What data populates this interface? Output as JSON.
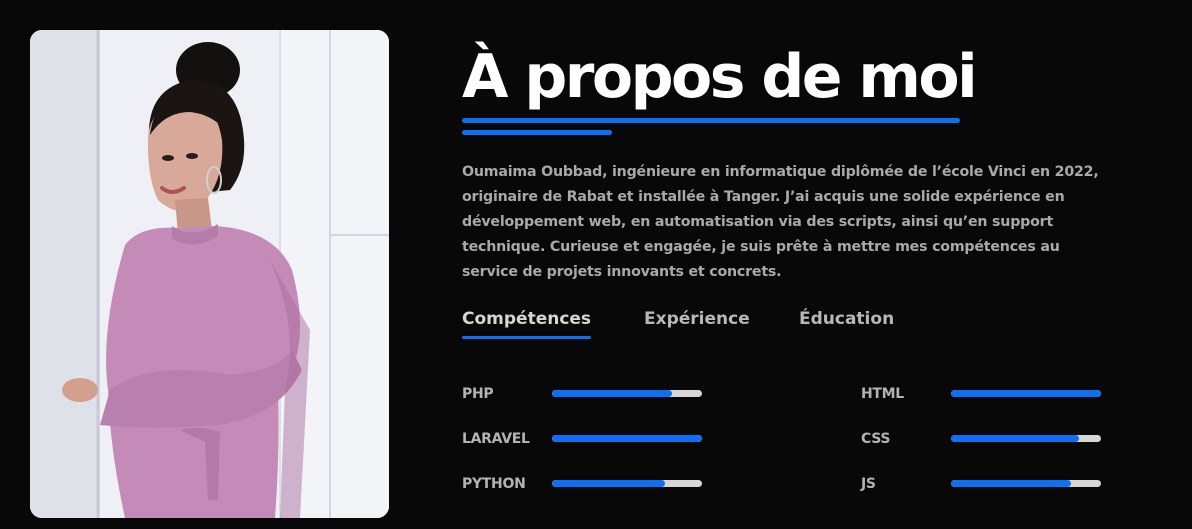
{
  "about": {
    "title": "À propos de moi",
    "bio": "Oumaima Oubbad, ingénieure en informatique diplômée de l’école Vinci en 2022, originaire de Rabat et installée à Tanger. J’ai acquis une solide expérience en développement web, en automatisation via des scripts, ainsi qu’en support technique. Curieuse et engagée, je suis prête à mettre mes compétences au service de projets innovants et concrets."
  },
  "tabs": [
    {
      "label": "Compétences",
      "active": true
    },
    {
      "label": "Expérience",
      "active": false
    },
    {
      "label": "Éducation",
      "active": false
    }
  ],
  "skills": [
    {
      "name": "PHP",
      "level": 0.8
    },
    {
      "name": "LARAVEL",
      "level": 1.0
    },
    {
      "name": "PYTHON",
      "level": 0.75
    },
    {
      "name": "HTML",
      "level": 1.0
    },
    {
      "name": "CSS",
      "level": 0.85
    },
    {
      "name": "JS",
      "level": 0.8
    }
  ],
  "colors": {
    "accent": "#0f6ff2",
    "background": "#080808",
    "bar_track": "#d6d6d6"
  }
}
